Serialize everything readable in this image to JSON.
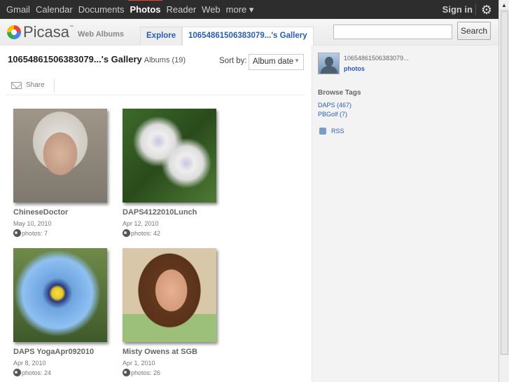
{
  "topbar": {
    "links": [
      "Gmail",
      "Calendar",
      "Documents",
      "Photos",
      "Reader",
      "Web",
      "more ▾"
    ],
    "active": "Photos",
    "signin": "Sign in",
    "gear_icon": "gear-icon"
  },
  "header": {
    "logo_word": "Picasa",
    "logo_tm": "™",
    "logo_sub": "Web Albums",
    "tabs": [
      "Explore",
      "10654861506383079...'s Gallery"
    ],
    "search_value": "",
    "search_button": "Search"
  },
  "main": {
    "title": "10654861506383079...'s Gallery",
    "albums_count": "Albums (19)",
    "sort_label": "Sort by:",
    "sort_value": "Album date",
    "share": "Share",
    "albums": [
      {
        "name": "ChineseDoctor",
        "date": "May 10, 2010",
        "photos": "photos: 7"
      },
      {
        "name": "DAPS4122010Lunch",
        "date": "Apr 12, 2010",
        "photos": "photos: 42"
      },
      {
        "name": "DAPS YogaApr092010",
        "date": "Apr 8, 2010",
        "photos": "photos: 24"
      },
      {
        "name": "Misty Owens at SGB",
        "date": "Apr 1, 2010",
        "photos": "photos: 26"
      }
    ]
  },
  "sidebar": {
    "user": "10654861506383079...",
    "photos_link": "photos",
    "browse_tags": "Browse Tags",
    "tags": [
      "DAPS (467)",
      "PBGolf (7)"
    ],
    "rss": "RSS"
  },
  "colors": {
    "topbar": "#2d2d2d",
    "link": "#2a5db0",
    "sidebar": "#f3f3f3",
    "active_accent": "#dd4b39"
  }
}
